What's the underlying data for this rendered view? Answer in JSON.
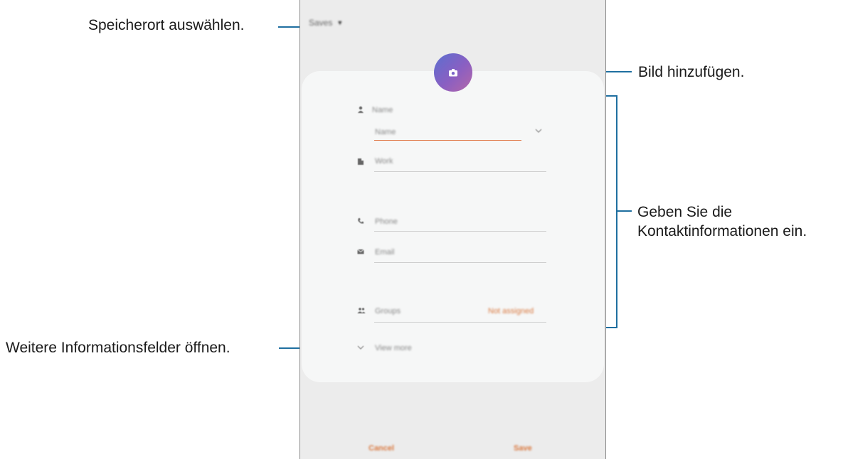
{
  "screen": {
    "storage": {
      "label": "Saves",
      "icon": "caret-down-icon"
    },
    "fields": {
      "name_label": "Name",
      "name_input": "Name",
      "work": "Work",
      "phone": "Phone",
      "email": "Email",
      "groups": "Groups",
      "groups_value": "Not assigned",
      "view_more": "View more"
    },
    "buttons": {
      "cancel": "Cancel",
      "save": "Save"
    }
  },
  "annotations": {
    "storage": "Speicherort auswählen.",
    "picture": "Bild hinzufügen.",
    "contact_1": "Geben Sie die",
    "contact_2": "Kontaktinformationen ein.",
    "more": "Weitere Informationsfelder öffnen."
  },
  "colors": {
    "leader": "#1f6fa0",
    "accent": "#d9783f"
  }
}
